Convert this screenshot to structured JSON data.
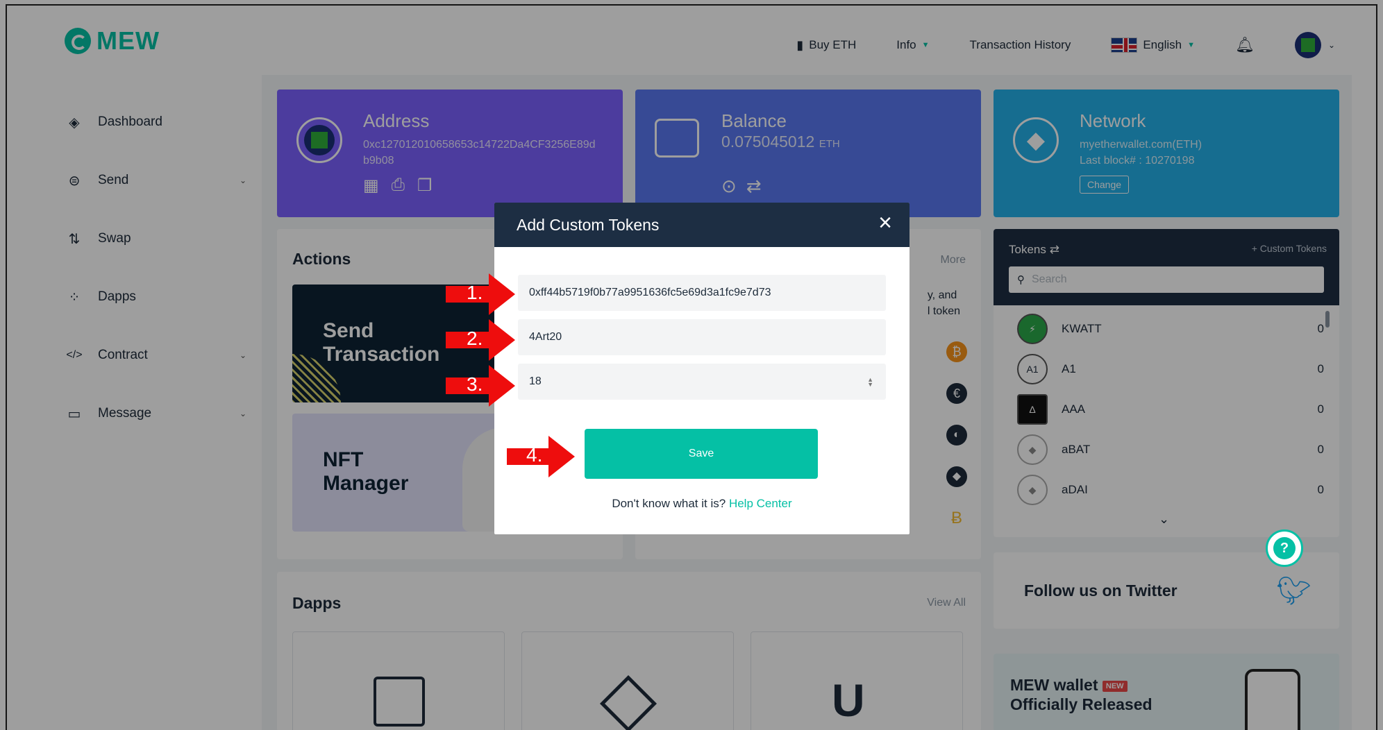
{
  "header": {
    "logo_text": "MEW",
    "buy_eth": "Buy ETH",
    "info": "Info",
    "transaction_history": "Transaction History",
    "language": "English"
  },
  "sidebar": {
    "items": [
      {
        "label": "Dashboard",
        "icon": "ethereum-icon"
      },
      {
        "label": "Send",
        "icon": "send-icon"
      },
      {
        "label": "Swap",
        "icon": "swap-icon"
      },
      {
        "label": "Dapps",
        "icon": "dapps-icon"
      },
      {
        "label": "Contract",
        "icon": "code-icon"
      },
      {
        "label": "Message",
        "icon": "message-icon"
      }
    ]
  },
  "address_card": {
    "title": "Address",
    "address_line1": "0xc127012010658653c14722Da4CF3256E89d",
    "address_line2": "b9b08"
  },
  "balance_card": {
    "title": "Balance",
    "amount": "0.075045012",
    "unit": "ETH"
  },
  "network_card": {
    "title": "Network",
    "network": "myetherwallet.com(ETH)",
    "last_block": "Last block# : 10270198",
    "change_label": "Change"
  },
  "actions": {
    "title": "Actions",
    "more_label": "More",
    "send_tile": "Send Transaction",
    "send_tile_line1": "Send",
    "send_tile_line2": "Transaction",
    "nft_line1": "NFT",
    "nft_line2": "Manager",
    "partial_text1": "y, and",
    "partial_text2": "l token"
  },
  "tokens": {
    "title": "Tokens",
    "custom_tokens_link": "+ Custom Tokens",
    "search_placeholder": "Search",
    "rows": [
      {
        "name": "KWATT",
        "value": "0"
      },
      {
        "name": "A1",
        "value": "0"
      },
      {
        "name": "AAA",
        "value": "0"
      },
      {
        "name": "aBAT",
        "value": "0"
      },
      {
        "name": "aDAI",
        "value": "0"
      }
    ]
  },
  "dapps": {
    "title": "Dapps",
    "view_all": "View All"
  },
  "twitter": {
    "title": "Follow us on Twitter"
  },
  "promo": {
    "line1": "MEW wallet",
    "badge": "NEW",
    "line2": "Officially Released"
  },
  "modal": {
    "title": "Add Custom Tokens",
    "contract_address": "0xff44b5719f0b77a9951636fc5e69d3a1fc9e7d73",
    "symbol": "4Art20",
    "decimals": "18",
    "save_label": "Save",
    "help_text": "Don't know what it is?",
    "help_link": "Help Center"
  },
  "annotations": {
    "step1": "1.",
    "step2": "2.",
    "step3": "3.",
    "step4": "4."
  },
  "colors": {
    "brand": "#05c0a5",
    "address_card": "#7b61ff",
    "balance_card": "#5a78f0",
    "network_card": "#25b0e8",
    "modal_header": "#1d2e43",
    "arrow": "#ee0d0d"
  }
}
